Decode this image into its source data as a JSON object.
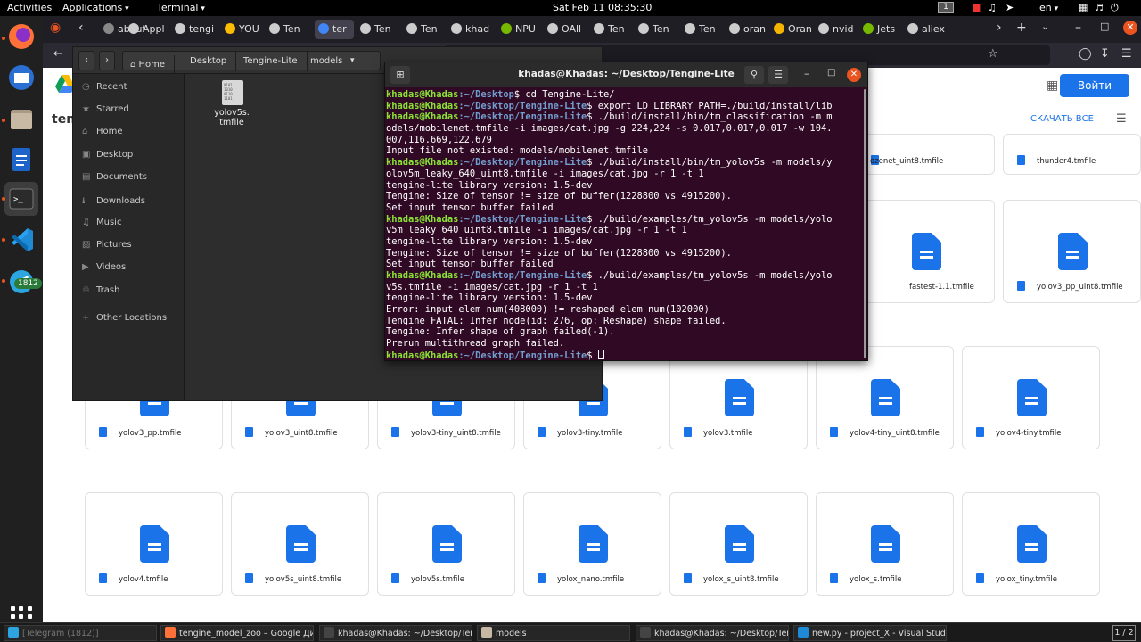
{
  "topbar": {
    "activities": "Activities",
    "applications": "Applications",
    "terminal_menu": "Terminal",
    "clock": "Sat Feb 11  08:35:30",
    "workspace": "1",
    "lang": "en"
  },
  "dock": {
    "telegram_badge": "1812"
  },
  "browser": {
    "tabs": [
      "about:s",
      "Appl",
      "tengi",
      "YOU",
      "Ten",
      "ter",
      "Ten",
      "Ten",
      "khad",
      "NPU",
      "OAll",
      "Ten",
      "Ten",
      "Ten",
      "oran",
      "Oran",
      "nvid",
      "Jets",
      "aliex"
    ]
  },
  "drive": {
    "title": "teng",
    "signin": "Войти",
    "download_all": "СКАЧАТЬ ВСЕ",
    "top_files": [
      "ozenet_uint8.tmfile",
      "thunder4.tmfile"
    ],
    "row2_files": [
      "fastest-1.1.tmfile",
      "yolov3_pp_uint8.tmfile"
    ],
    "row3_files": [
      "yolov3_pp.tmfile",
      "yolov3_uint8.tmfile",
      "yolov3-tiny_uint8.tmfile",
      "yolov3-tiny.tmfile",
      "yolov3.tmfile",
      "yolov4-tiny_uint8.tmfile",
      "yolov4-tiny.tmfile"
    ],
    "row4_files": [
      "yolov4.tmfile",
      "yolov5s_uint8.tmfile",
      "yolov5s.tmfile",
      "yolox_nano.tmfile",
      "yolox_s_uint8.tmfile",
      "yolox_s.tmfile",
      "yolox_tiny.tmfile"
    ]
  },
  "files": {
    "breadcrumbs": [
      "Home",
      "Desktop",
      "Tengine-Lite",
      "models"
    ],
    "sidebar": [
      "Recent",
      "Starred",
      "Home",
      "Desktop",
      "Documents",
      "Downloads",
      "Music",
      "Pictures",
      "Videos",
      "Trash",
      "Other Locations"
    ],
    "file_name_1": "yolov5s.",
    "file_name_2": "tmfile",
    "file_icon_text": "0101 1010 0110 1101"
  },
  "terminal": {
    "title": "khadas@Khadas: ~/Desktop/Tengine-Lite",
    "user": "khadas@Khadas",
    "lines": [
      {
        "p": ":~/Desktop",
        "c": "$ cd Tengine-Lite/"
      },
      {
        "p": ":~/Desktop/Tengine-Lite",
        "c": "$ export LD_LIBRARY_PATH=./build/install/lib"
      },
      {
        "p": ":~/Desktop/Tengine-Lite",
        "c": "$ ./build/install/bin/tm_classification -m m"
      },
      {
        "t": "odels/mobilenet.tmfile -i images/cat.jpg -g 224,224 -s 0.017,0.017,0.017 -w 104."
      },
      {
        "t": "007,116.669,122.679"
      },
      {
        "t": "Input file not existed: models/mobilenet.tmfile"
      },
      {
        "p": ":~/Desktop/Tengine-Lite",
        "c": "$ ./build/install/bin/tm_yolov5s -m models/y"
      },
      {
        "t": "olov5m_leaky_640_uint8.tmfile -i images/cat.jpg -r 1 -t 1"
      },
      {
        "t": "tengine-lite library version: 1.5-dev"
      },
      {
        "t": "Tengine: Size of tensor != size of buffer(1228800 vs 4915200)."
      },
      {
        "t": "Set input tensor buffer failed"
      },
      {
        "p": ":~/Desktop/Tengine-Lite",
        "c": "$ ./build/examples/tm_yolov5s -m models/yolo"
      },
      {
        "t": "v5m_leaky_640_uint8.tmfile -i images/cat.jpg -r 1 -t 1"
      },
      {
        "t": "tengine-lite library version: 1.5-dev"
      },
      {
        "t": "Tengine: Size of tensor != size of buffer(1228800 vs 4915200)."
      },
      {
        "t": "Set input tensor buffer failed"
      },
      {
        "p": ":~/Desktop/Tengine-Lite",
        "c": "$ ./build/examples/tm_yolov5s -m models/yolo"
      },
      {
        "t": "v5s.tmfile -i images/cat.jpg -r 1 -t 1"
      },
      {
        "t": "tengine-lite library version: 1.5-dev"
      },
      {
        "t": "Error: input elem num(408000) != reshaped elem num(102000)"
      },
      {
        "t": "Tengine FATAL: Infer node(id: 276, op: Reshape) shape failed."
      },
      {
        "t": "Tengine: Infer shape of graph failed(-1)."
      },
      {
        "t": "Prerun multithread graph failed."
      },
      {
        "p": ":~/Desktop/Tengine-Lite",
        "c": "$ ",
        "cursor": true
      }
    ]
  },
  "taskbar": {
    "tasks": [
      "[Telegram (1812)]",
      "tengine_model_zoo – Google Дис...",
      "khadas@Khadas: ~/Desktop/Tengi...",
      "models",
      "khadas@Khadas: ~/Desktop/Tengi...",
      "new.py - project_X - Visual Studio ..."
    ],
    "pager": "1 / 2"
  }
}
